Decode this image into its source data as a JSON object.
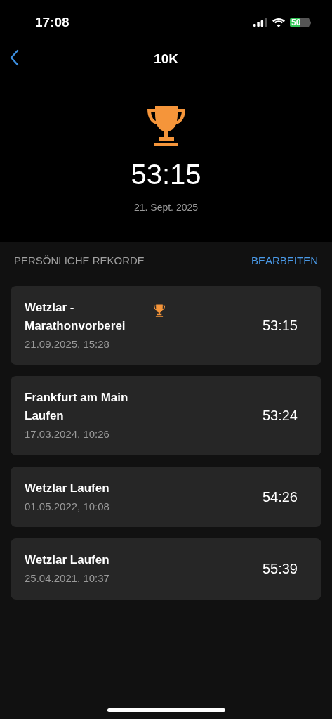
{
  "status_bar": {
    "time": "17:08",
    "battery": "50"
  },
  "nav": {
    "title": "10K"
  },
  "hero": {
    "time": "53:15",
    "date": "21. Sept. 2025"
  },
  "section": {
    "title": "PERSÖNLICHE REKORDE",
    "action": "BEARBEITEN"
  },
  "records": [
    {
      "title": "Wetzlar - Marathonvorberei",
      "date": "21.09.2025, 15:28",
      "time": "53:15",
      "best": true
    },
    {
      "title": "Frankfurt am Main Laufen",
      "date": "17.03.2024, 10:26",
      "time": "53:24",
      "best": false
    },
    {
      "title": "Wetzlar Laufen",
      "date": "01.05.2022, 10:08",
      "time": "54:26",
      "best": false
    },
    {
      "title": "Wetzlar Laufen",
      "date": "25.04.2021, 10:37",
      "time": "55:39",
      "best": false
    }
  ]
}
